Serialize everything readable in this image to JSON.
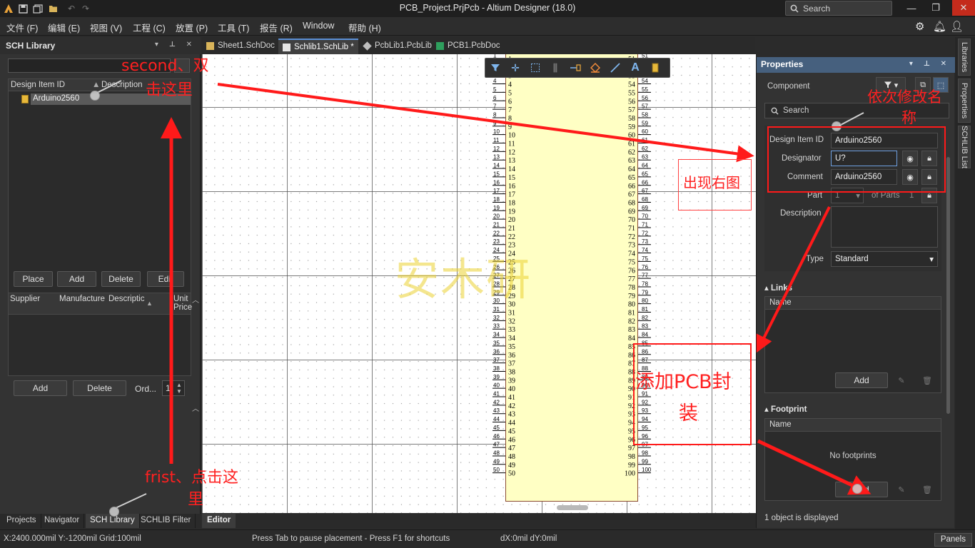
{
  "window": {
    "title": "PCB_Project.PrjPcb - Altium Designer (18.0)",
    "search_placeholder": "Search"
  },
  "menu": [
    "文件 (F)",
    "编辑 (E)",
    "视图 (V)",
    "工程 (C)",
    "放置 (P)",
    "工具 (T)",
    "报告 (R)",
    "Window",
    "帮助 (H)"
  ],
  "left_panel": {
    "title": "SCH Library",
    "columns": [
      "Design Item ID",
      "Description"
    ],
    "components": [
      "Arduino2560"
    ],
    "buttons": [
      "Place",
      "Add",
      "Delete",
      "Edit"
    ],
    "supplier_columns": [
      "Supplier",
      "Manufacture",
      "Descriptic",
      "Unit Price"
    ],
    "supplier_buttons": [
      "Add",
      "Delete"
    ],
    "order_label": "Ord...",
    "order_value": "1"
  },
  "left_tabs": [
    "Projects",
    "Navigator",
    "SCH Library",
    "SCHLIB Filter"
  ],
  "doc_tabs": [
    "Sheet1.SchDoc",
    "Schlib1.SchLib *",
    "PcbLib1.PcbLib",
    "PCB1.PcbDoc"
  ],
  "canvas": {
    "pins_left": [
      "1",
      "2",
      "3",
      "4",
      "5",
      "6",
      "7",
      "8",
      "9",
      "10",
      "11",
      "12",
      "13",
      "14",
      "15",
      "16",
      "17",
      "18",
      "19",
      "20",
      "21",
      "22",
      "23",
      "24",
      "25",
      "26",
      "27",
      "28",
      "29",
      "30",
      "31",
      "32",
      "33",
      "34",
      "35",
      "36",
      "37",
      "38",
      "39",
      "40",
      "41",
      "42",
      "43",
      "44",
      "45",
      "46",
      "47",
      "48",
      "49",
      "50"
    ],
    "pins_right": [
      "51",
      "52",
      "53",
      "54",
      "55",
      "56",
      "57",
      "58",
      "59",
      "60",
      "61",
      "62",
      "63",
      "64",
      "65",
      "66",
      "67",
      "68",
      "69",
      "70",
      "71",
      "72",
      "73",
      "74",
      "75",
      "76",
      "77",
      "78",
      "79",
      "80",
      "81",
      "82",
      "83",
      "84",
      "85",
      "86",
      "87",
      "88",
      "89",
      "90",
      "91",
      "92",
      "93",
      "94",
      "95",
      "96",
      "97",
      "98",
      "99",
      "100"
    ],
    "watermark": "安木研"
  },
  "editor_tab": "Editor",
  "properties": {
    "title": "Properties",
    "kind": "Component",
    "search_placeholder": "Search",
    "design_item_id_label": "Design Item ID",
    "design_item_id": "Arduino2560",
    "designator_label": "Designator",
    "designator": "U?",
    "comment_label": "Comment",
    "comment": "Arduino2560",
    "part_label": "Part",
    "part_value": "1",
    "of_parts_label": "of Parts",
    "of_parts_value": "1",
    "description_label": "Description",
    "type_label": "Type",
    "type_value": "Standard",
    "links_title": "Links",
    "links_col": "Name",
    "links_add": "Add",
    "footprint_title": "Footprint",
    "footprint_col": "Name",
    "no_footprints": "No footprints",
    "footprint_add": "Add",
    "status": "1 object is displayed"
  },
  "side_tabs": [
    "Libraries",
    "Properties",
    "SCHLIB List"
  ],
  "statusbar": {
    "coords": "X:2400.000mil Y:-1200mil   Grid:100mil",
    "hint": "Press Tab to pause placement - Press F1 for shortcuts",
    "delta": "dX:0mil dY:0mil",
    "panels": "Panels"
  },
  "annotations": {
    "second_line1": "second、双",
    "second_line2": "击这里",
    "first_line1": "frist、点击这",
    "first_line2": "里",
    "rename_line1": "依次修改名",
    "rename_line2": "称",
    "appears": "出现右图",
    "add_pcb_line1": "添加PCB封",
    "add_pcb_line2": "装"
  },
  "colors": {
    "annotation": "#ff2020",
    "properties_header": "#46607e",
    "component_body": "#ffffc4"
  }
}
